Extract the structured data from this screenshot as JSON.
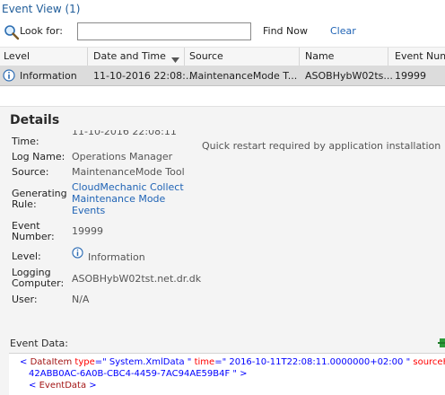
{
  "title": "Event View (1)",
  "toolbar": {
    "look_for_label": "Look for:",
    "search_value": "",
    "find_now": "Find Now",
    "clear": "Clear"
  },
  "columns": [
    "Level",
    "Date and Time",
    "Source",
    "Name",
    "Event Numb"
  ],
  "row": {
    "level": "Information",
    "date": "11-10-2016 22:08:...",
    "source": "MaintenanceMode T...",
    "name": "ASOBHybW02ts...",
    "number": "19999"
  },
  "details": {
    "heading": "Details",
    "time_label": "Time:",
    "time_value": "11-10-2016 22:08:11",
    "log_name_label": "Log Name:",
    "log_name_value": "Operations Manager",
    "source_label": "Source:",
    "source_value": "MaintenanceMode Tool",
    "rule_label_1": "Generating",
    "rule_label_2": "Rule:",
    "rule_value_1": "CloudMechanic Collect",
    "rule_value_2": "Maintenance Mode",
    "rule_value_3": "Events",
    "number_label_1": "Event",
    "number_label_2": "Number:",
    "number_value": "19999",
    "level_label": "Level:",
    "level_value": "Information",
    "computer_label_1": "Logging",
    "computer_label_2": "Computer:",
    "computer_value": "ASOBHybW02tst.net.dr.dk",
    "user_label": "User:",
    "user_value": "N/A",
    "message": "Quick restart required by application installation"
  },
  "event_data": {
    "label": "Event Data:",
    "line1": {
      "open": "<",
      "tag": "DataItem",
      "a1": "type",
      "v1": "=\" System.XmlData \"",
      "a2": "time",
      "v2": "=\" 2016-10-11T22:08:11.0000000+02:00 \"",
      "a3": "sourceHe"
    },
    "line2": "42ABB0AC-6A0B-CBC4-4459-7AC94AE59B4F \" >",
    "line3": {
      "open": "<",
      "tag": "EventData",
      "close": ">"
    }
  }
}
